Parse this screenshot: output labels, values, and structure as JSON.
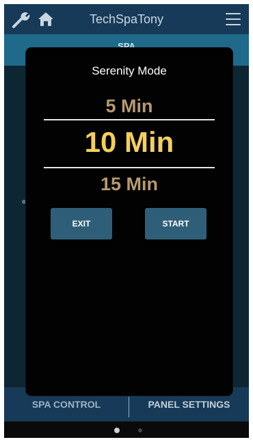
{
  "app": {
    "title": "TechSpaTony",
    "tab_label": "SPA"
  },
  "icons": {
    "wrench": "wrench-icon",
    "home": "home-icon",
    "menu": "hamburger-menu-icon"
  },
  "modal": {
    "title": "Serenity Mode",
    "options": [
      "5 Min",
      "10 Min",
      "15 Min"
    ],
    "selected": "10 Min",
    "exit_label": "EXIT",
    "start_label": "START"
  },
  "bottom_nav": {
    "left": "SPA CONTROL",
    "right": "PANEL SETTINGS"
  },
  "pager": {
    "current_page": 1,
    "total_pages": 2
  },
  "colors": {
    "topbar": "#163a57",
    "tabstrip": "#1f6a8a",
    "selected_option": "#f5cf5a",
    "unselected_option": "#b79a6e",
    "button": "#2f5f78"
  }
}
